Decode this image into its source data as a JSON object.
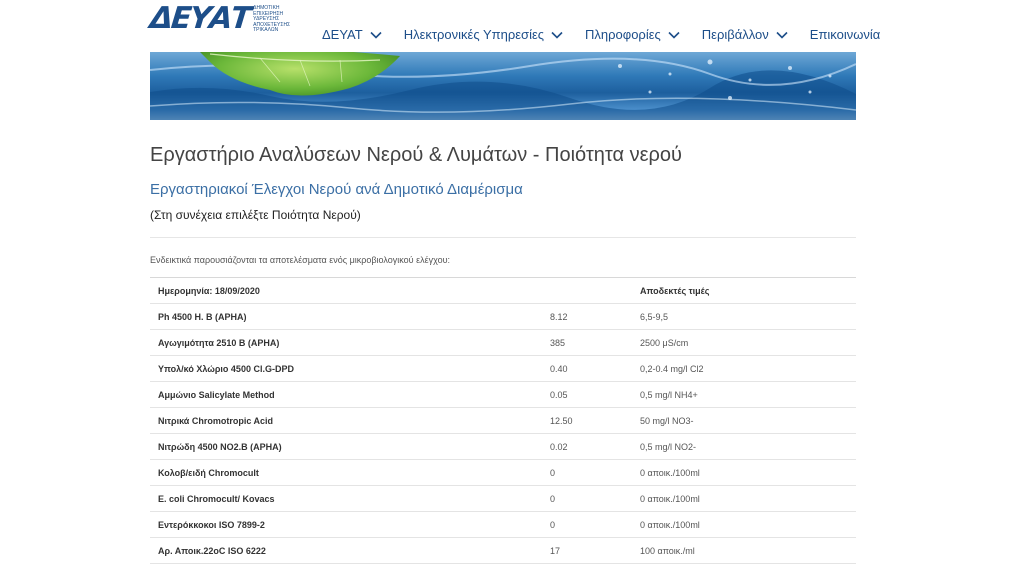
{
  "logo": {
    "mark": "ΔΕΥΑΤ",
    "sub": "ΔΗΜΟΤΙΚΗ\nΕΠΙΧΕΙΡΗΣΗ\nΥΔΡΕΥΣΗΣ\nΑΠΟΧΕΤΕΥΣΗΣ\nΤΡΙΚΑΛΩΝ"
  },
  "nav": [
    {
      "label": "ΔΕΥΑΤ",
      "dropdown": true
    },
    {
      "label": "Ηλεκτρονικές Υπηρεσίες",
      "dropdown": true
    },
    {
      "label": "Πληροφορίες",
      "dropdown": true
    },
    {
      "label": "Περιβάλλον",
      "dropdown": true
    },
    {
      "label": "Επικοινωνία",
      "dropdown": false
    }
  ],
  "page": {
    "title": "Εργαστήριο Αναλύσεων Νερού & Λυμάτων - Ποιότητα νερού",
    "subtitle": "Εργαστηριακοί Έλεγχοι Νερού ανά Δημοτικό Διαμέρισμα",
    "note": "(Στη συνέχεια επιλέξτε Ποιότητα Νερού)",
    "intro": "Ενδεικτικά παρουσιάζονται τα αποτελέσματα ενός μικροβιολογικού ελέγχου:"
  },
  "table": {
    "header": {
      "date": "Ημερομηνία: 18/09/2020",
      "value": "",
      "limit": "Αποδεκτές τιμές"
    },
    "rows": [
      {
        "param": "Ph 4500 H. B (APHA)",
        "value": "8.12",
        "limit": "6,5-9,5"
      },
      {
        "param": "Αγωγιμότητα 2510 B (APHA)",
        "value": "385",
        "limit": "2500 μS/cm"
      },
      {
        "param": "Υπολ/κό Χλώριο 4500 Cl.G-DPD",
        "value": "0.40",
        "limit": "0,2-0.4 mg/l Cl2"
      },
      {
        "param": "Αμμώνιο Salicylate Method",
        "value": "0.05",
        "limit": "0,5 mg/l NH4+"
      },
      {
        "param": "Νιτρικά Chromotropic Acid",
        "value": "12.50",
        "limit": "50 mg/l NO3-"
      },
      {
        "param": "Νιτρώδη 4500 NO2.B (APHA)",
        "value": "0.02",
        "limit": "0,5 mg/l NO2-"
      },
      {
        "param": "Κολοβ/ειδή Chromocult",
        "value": "0",
        "limit": "0 αποικ./100ml"
      },
      {
        "param": "E. coli Chromocult/ Kovacs",
        "value": "0",
        "limit": "0 αποικ./100ml"
      },
      {
        "param": "Εντερόκκοκοι ISO 7899-2",
        "value": "0",
        "limit": "0 αποικ./100ml"
      },
      {
        "param": "Αρ. Αποικ.22oC ISO 6222",
        "value": "17",
        "limit": "100 αποικ./ml"
      }
    ]
  }
}
